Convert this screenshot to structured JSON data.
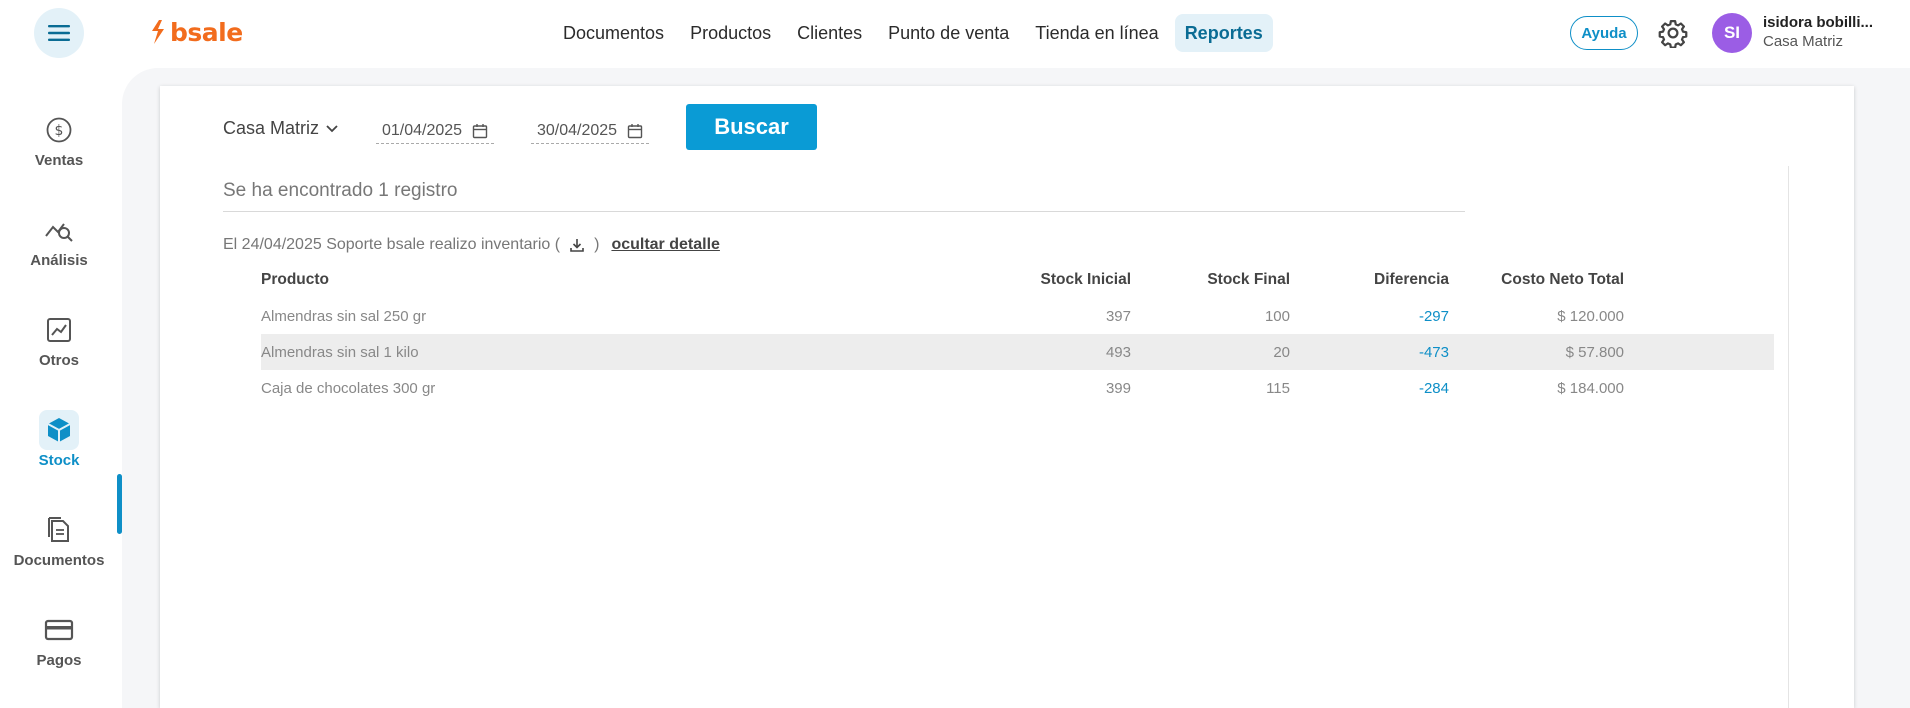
{
  "app": {
    "logo_text": "bsale",
    "brand_color": "#f26c1d",
    "accent_color": "#0e8fc7"
  },
  "topnav": [
    {
      "label": "Documentos"
    },
    {
      "label": "Productos"
    },
    {
      "label": "Clientes"
    },
    {
      "label": "Punto de venta"
    },
    {
      "label": "Tienda en línea"
    },
    {
      "label": "Reportes",
      "active": true
    }
  ],
  "header": {
    "help_label": "Ayuda",
    "avatar_initials": "SI",
    "user_name": "isidora bobilli...",
    "user_branch": "Casa Matriz"
  },
  "sidebar": {
    "items": [
      {
        "label": "Ventas",
        "icon": "dollar-circle-icon"
      },
      {
        "label": "Análisis",
        "icon": "analytics-icon"
      },
      {
        "label": "Otros",
        "icon": "chart-square-icon"
      },
      {
        "label": "Stock",
        "icon": "box-icon",
        "active": true
      },
      {
        "label": "Documentos",
        "icon": "document-icon"
      },
      {
        "label": "Pagos",
        "icon": "credit-card-icon"
      }
    ]
  },
  "filters": {
    "branch": "Casa Matriz",
    "date_from": "01/04/2025",
    "date_to": "30/04/2025",
    "search_label": "Buscar"
  },
  "results": {
    "summary": "Se ha encontrado 1 registro",
    "inventory_text": "El 24/04/2025 Soporte bsale realizo inventario (",
    "inventory_close": ")",
    "hide_detail": "ocultar detalle"
  },
  "table": {
    "headers": [
      "Producto",
      "Stock Inicial",
      "Stock Final",
      "Diferencia",
      "Costo Neto Total"
    ],
    "rows": [
      {
        "producto": "Almendras sin sal 250 gr",
        "inicial": "397",
        "final": "100",
        "diferencia": "-297",
        "costo": "$ 120.000"
      },
      {
        "producto": "Almendras sin sal 1 kilo",
        "inicial": "493",
        "final": "20",
        "diferencia": "-473",
        "costo": "$ 57.800"
      },
      {
        "producto": "Caja de chocolates 300 gr",
        "inicial": "399",
        "final": "115",
        "diferencia": "-284",
        "costo": "$ 184.000"
      }
    ]
  }
}
